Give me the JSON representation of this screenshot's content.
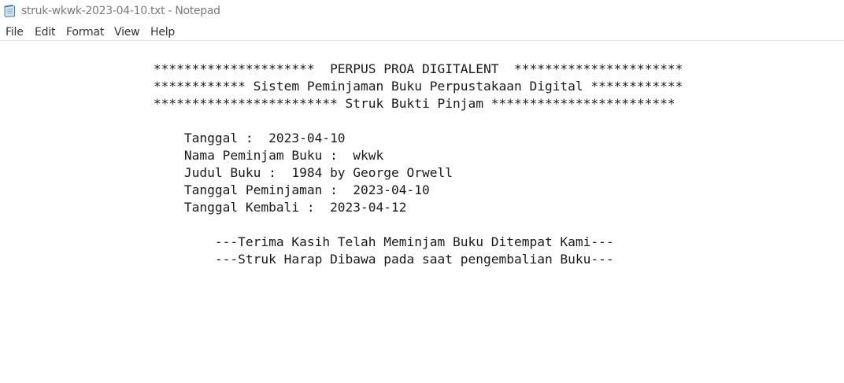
{
  "window": {
    "title": "struk-wkwk-2023-04-10.txt - Notepad"
  },
  "menu": {
    "items": [
      "File",
      "Edit",
      "Format",
      "View",
      "Help"
    ]
  },
  "document": {
    "lines": [
      "                    *********************  PERPUS PROA DIGITALENT  **********************",
      "                    ************ Sistem Peminjaman Buku Perpustakaan Digital ************",
      "                    ************************ Struk Bukti Pinjam ************************",
      "",
      "                        Tanggal :  2023-04-10",
      "                        Nama Peminjam Buku :  wkwk",
      "                        Judul Buku :  1984 by George Orwell",
      "                        Tanggal Peminjaman :  2023-04-10",
      "                        Tanggal Kembali :  2023-04-12",
      "",
      "                            ---Terima Kasih Telah Meminjam Buku Ditempat Kami---",
      "                            ---Struk Harap Dibawa pada saat pengembalian Buku---"
    ]
  },
  "icons": {
    "app": "notepad-icon"
  }
}
